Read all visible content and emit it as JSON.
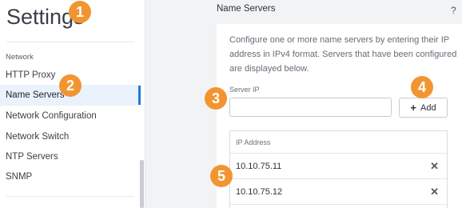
{
  "sidebar": {
    "title": "Settings",
    "section": "Network",
    "items": [
      {
        "label": "HTTP Proxy"
      },
      {
        "label": "Name Servers"
      },
      {
        "label": "Network Configuration"
      },
      {
        "label": "Network Switch"
      },
      {
        "label": "NTP Servers"
      },
      {
        "label": "SNMP"
      }
    ],
    "active_item": "Name Servers"
  },
  "header": {
    "title": "Name Servers",
    "help_icon": "question-mark-icon",
    "help_glyph": "?"
  },
  "panel": {
    "description": "Configure one or more name servers by entering their IP address in IPv4 format. Servers that have been configured are displayed below.",
    "server_ip_label": "Server IP",
    "server_ip_value": "",
    "add_label": "Add",
    "add_icon": "plus-icon",
    "add_glyph": "+",
    "table_header": "IP Address",
    "rows": [
      {
        "ip": "10.10.75.11",
        "remove_icon": "close-icon",
        "remove_glyph": "✕"
      },
      {
        "ip": "10.10.75.12",
        "remove_icon": "close-icon",
        "remove_glyph": "✕"
      }
    ]
  },
  "callouts": [
    "1",
    "2",
    "3",
    "4",
    "5"
  ],
  "colors": {
    "accent": "#1f7ad6",
    "callout": "#f29531",
    "active_bg": "#eaf2fb"
  }
}
